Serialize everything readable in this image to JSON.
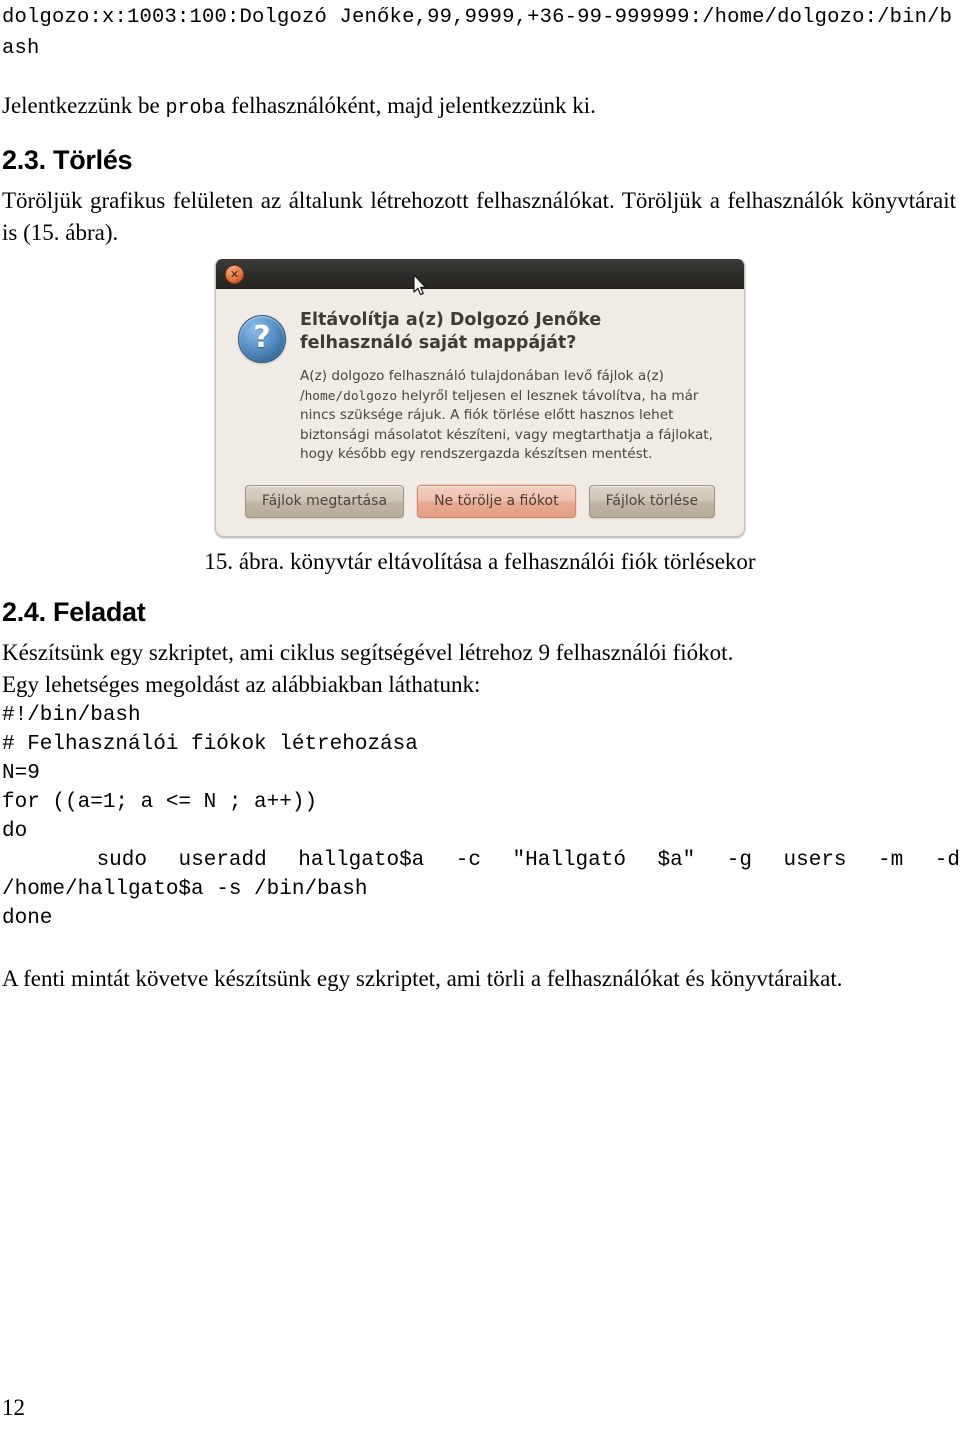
{
  "document": {
    "page_number": "12",
    "top_listing": "dolgozo:x:1003:100:Dolgozó Jenőke,99,9999,+36-99-999999:/home/dolgozo:/bin/bash",
    "intro_paragraph": {
      "before_code": "Jelentkezzünk be ",
      "code_word": "proba",
      "after_code": " felhasználóként, majd jelentkezzünk ki."
    },
    "sections": [
      {
        "number": "2.3.",
        "title": "Törlés",
        "heading_full": "2.3. Törlés",
        "paragraph": "Töröljük grafikus felületen az általunk létrehozott felhasználókat. Töröljük a felhasználók könyvtárait is (15. ábra)."
      },
      {
        "number": "2.4.",
        "title": "Feladat",
        "heading_full": "2.4. Feladat",
        "paragraph_line1": "Készítsünk egy szkriptet, ami ciklus segítségével létrehoz 9 felhasználói fiókot.",
        "paragraph_line2": "Egy lehetséges megoldást az alábbiakban láthatunk:"
      }
    ],
    "figure": {
      "caption": "15. ábra. könyvtár eltávolítása a felhasználói fiók törlésekor",
      "dialog": {
        "close_button_glyph": "✕",
        "icon_glyph": "?",
        "icon_name": "question-icon",
        "heading": "Eltávolítja a(z) Dolgozó Jenőke felhasználó saját mappáját?",
        "message_part1": "A(z) dolgozo felhasználó tulajdonában levő fájlok a(z) /",
        "message_path": "home/dolgozo",
        "message_part2": " helyről teljesen el lesznek távolítva, ha már nincs szüksége rájuk. A fiók törlése előtt hasznos lehet biztonsági másolatot készíteni, vagy megtarthatja a fájlokat, hogy később egy rendszergazda készítsen mentést.",
        "buttons": [
          {
            "label": "Fájlok megtartása",
            "focused": false
          },
          {
            "label": "Ne törölje a fiókot",
            "focused": true
          },
          {
            "label": "Fájlok törlése",
            "focused": false
          }
        ],
        "colors": {
          "titlebar": "#2e2d2a",
          "background": "#f0ebe4",
          "close_button": "#e4713c",
          "icon": "#5a93c9",
          "focused_button": "#e8ab92"
        }
      }
    },
    "code_block": {
      "lines": [
        "#!/bin/bash",
        "# Felhasználói fiókok létrehozása",
        "N=9",
        "for ((a=1; a <= N ; a++))",
        "do",
        "   sudo useradd hallgato$a -c \"Hallgató $a\" -g users -m -d",
        "/home/hallgato$a -s /bin/bash",
        "done"
      ],
      "line_indented_justified_index": 5
    },
    "closing_paragraph": "A fenti mintát követve készítsünk egy szkriptet, ami törli a felhasználókat és könyvtáraikat."
  }
}
